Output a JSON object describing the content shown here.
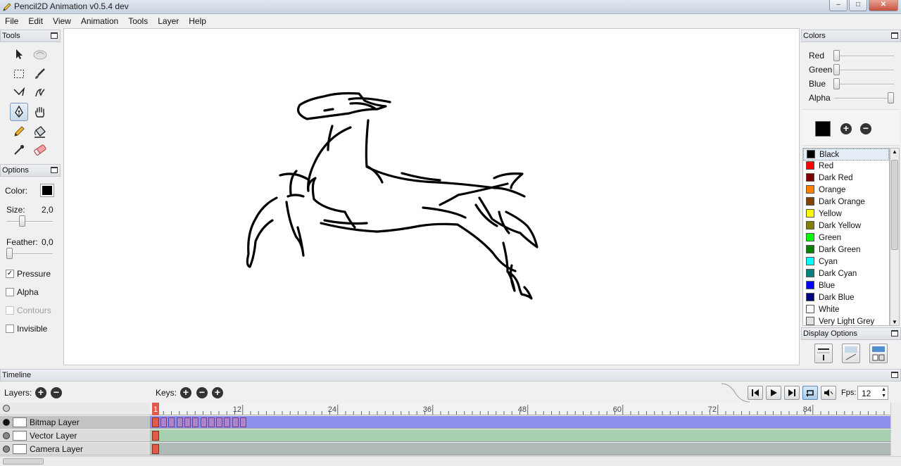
{
  "window": {
    "title": "Pencil2D Animation v0.5.4 dev",
    "controls": [
      "–",
      "□",
      "✕"
    ]
  },
  "menu": [
    "File",
    "Edit",
    "View",
    "Animation",
    "Tools",
    "Layer",
    "Help"
  ],
  "tools_panel": {
    "title": "Tools",
    "tools": [
      "move-tool",
      "smudge-tool",
      "select-tool",
      "brush-tool",
      "polyline-tool",
      "smudge-brush-tool",
      "pen-tool",
      "hand-tool",
      "pencil-tool",
      "bucket-tool",
      "eyedropper-tool",
      "eraser-tool"
    ],
    "active_tool": "pen-tool"
  },
  "options_panel": {
    "title": "Options",
    "color_label": "Color:",
    "color_value": "#000000",
    "size_label": "Size:",
    "size_value": "2,0",
    "feather_label": "Feather:",
    "feather_value": "0,0",
    "checkboxes": [
      {
        "label": "Pressure",
        "checked": true,
        "enabled": true
      },
      {
        "label": "Alpha",
        "checked": false,
        "enabled": true
      },
      {
        "label": "Contours",
        "checked": false,
        "enabled": false
      },
      {
        "label": "Invisible",
        "checked": false,
        "enabled": true
      }
    ]
  },
  "colors_panel": {
    "title": "Colors",
    "sliders": [
      {
        "label": "Red",
        "level": 0
      },
      {
        "label": "Green",
        "level": 0
      },
      {
        "label": "Blue",
        "level": 0
      },
      {
        "label": "Alpha",
        "level": 1
      }
    ],
    "current_color": "#000000",
    "palette": [
      {
        "name": "Black",
        "hex": "#000000",
        "selected": true
      },
      {
        "name": "Red",
        "hex": "#ff0000"
      },
      {
        "name": "Dark Red",
        "hex": "#800000"
      },
      {
        "name": "Orange",
        "hex": "#ff8000"
      },
      {
        "name": "Dark Orange",
        "hex": "#804000"
      },
      {
        "name": "Yellow",
        "hex": "#ffff00"
      },
      {
        "name": "Dark Yellow",
        "hex": "#808000"
      },
      {
        "name": "Green",
        "hex": "#00ff00"
      },
      {
        "name": "Dark Green",
        "hex": "#008000"
      },
      {
        "name": "Cyan",
        "hex": "#00ffff"
      },
      {
        "name": "Dark Cyan",
        "hex": "#008080"
      },
      {
        "name": "Blue",
        "hex": "#0000ff"
      },
      {
        "name": "Dark Blue",
        "hex": "#000080"
      },
      {
        "name": "White",
        "hex": "#ffffff"
      },
      {
        "name": "Very Light Grey",
        "hex": "#e0e0e0"
      }
    ]
  },
  "display_options": {
    "title": "Display Options"
  },
  "timeline": {
    "title": "Timeline",
    "layers_label": "Layers:",
    "keys_label": "Keys:",
    "fps_label": "Fps:",
    "fps_value": "12",
    "ruler_labels": [
      "1",
      "12",
      "24",
      "36",
      "48",
      "60",
      "72",
      "84"
    ],
    "layers": [
      {
        "name": "Bitmap Layer",
        "type": "bitmap",
        "color": "#8f8ff0",
        "selected": true
      },
      {
        "name": "Vector Layer",
        "type": "vector",
        "color": "#a6d0b0",
        "selected": false
      },
      {
        "name": "Camera Layer",
        "type": "camera",
        "color": "#b0bab6",
        "selected": false
      }
    ],
    "keyframe_count": 11
  }
}
